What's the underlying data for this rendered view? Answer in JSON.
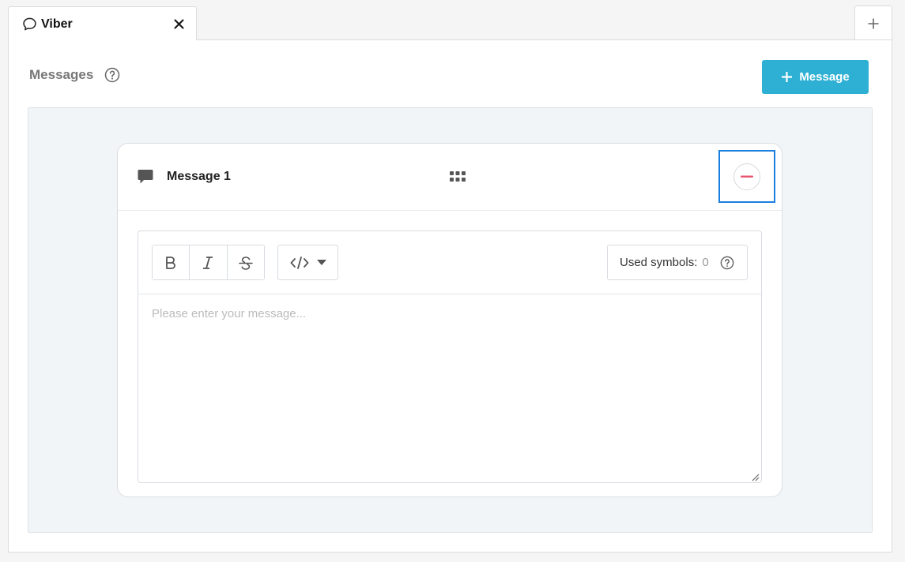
{
  "tabs": [
    {
      "label": "Viber",
      "icon": "chat-bubble-icon",
      "active": true
    }
  ],
  "panel": {
    "title": "Messages",
    "add_button_label": "Message"
  },
  "message": {
    "title": "Message 1",
    "placeholder": "Please enter your message...",
    "used_symbols_label": "Used symbols:",
    "used_symbols_count": "0",
    "format_buttons": [
      "B",
      "I",
      "S"
    ]
  },
  "colors": {
    "accent": "#2eb0d4",
    "focus_outline": "#1a7fe0",
    "remove_red": "#e8546c"
  }
}
